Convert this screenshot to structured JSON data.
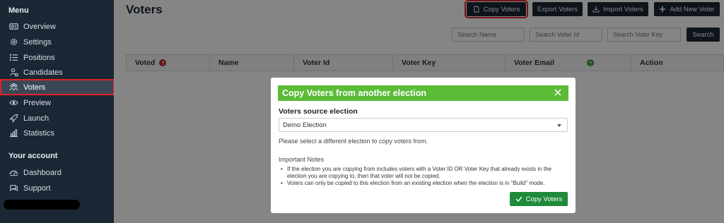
{
  "sidebar": {
    "menu_heading": "Menu",
    "items": [
      {
        "label": "Overview",
        "icon": "overview-icon"
      },
      {
        "label": "Settings",
        "icon": "gear-icon"
      },
      {
        "label": "Positions",
        "icon": "list-icon"
      },
      {
        "label": "Candidates",
        "icon": "candidates-icon"
      },
      {
        "label": "Voters",
        "icon": "voters-icon"
      },
      {
        "label": "Preview",
        "icon": "eye-icon"
      },
      {
        "label": "Launch",
        "icon": "rocket-icon"
      },
      {
        "label": "Statistics",
        "icon": "chart-icon"
      }
    ],
    "account_heading": "Your account",
    "account_items": [
      {
        "label": "Dashboard",
        "icon": "dashboard-icon"
      },
      {
        "label": "Support",
        "icon": "support-icon"
      }
    ]
  },
  "header": {
    "title": "Voters",
    "copy_voters": "Copy Voters",
    "export_voters": "Export Voters",
    "import_voters": "Import Voters",
    "add_new_voter": "Add New Voter"
  },
  "search": {
    "name_placeholder": "Search Name",
    "voter_id_placeholder": "Search Voter Id",
    "voter_key_placeholder": "Search Voter Key",
    "button": "Search"
  },
  "table": {
    "columns": [
      "Voted",
      "Name",
      "Voter Id",
      "Voter Key",
      "Voter Email",
      "Action"
    ]
  },
  "modal": {
    "title": "Copy Voters from another election",
    "source_label": "Voters source election",
    "selected_election": "Demo Election",
    "hint": "Please select a different election to copy voters from.",
    "notes_title": "Important Notes",
    "notes": [
      "If the election you are copying from includes voters with a Voter ID OR Voter Key that already exists in the election you are copying to, then that voter will not be copied.",
      "Voters can only be copied to this election from an existing election when the election is in \"Build\" mode."
    ],
    "submit": "Copy Voters"
  },
  "colors": {
    "sidebar_bg": "#1b2735",
    "modal_header": "#5bbc38",
    "submit_button": "#1e8a3a",
    "highlight": "#e02424"
  }
}
